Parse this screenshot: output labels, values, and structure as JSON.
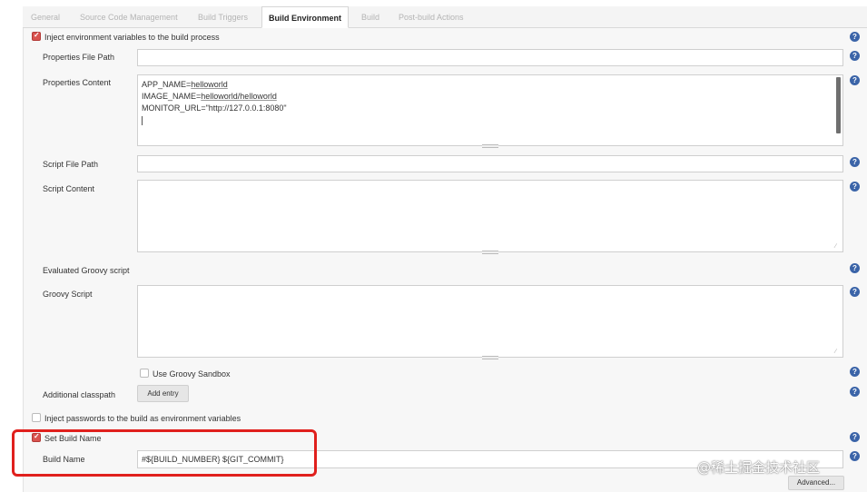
{
  "tabs": [
    {
      "label": "General"
    },
    {
      "label": "Source Code Management"
    },
    {
      "label": "Build Triggers"
    },
    {
      "label": "Build Environment"
    },
    {
      "label": "Build"
    },
    {
      "label": "Post-build Actions"
    }
  ],
  "active_tab": "Build Environment",
  "inject_env": {
    "checkbox_label": "Inject environment variables to the build process",
    "checked": true,
    "properties_file_path": {
      "label": "Properties File Path",
      "value": ""
    },
    "properties_content": {
      "label": "Properties Content",
      "lines": [
        {
          "key": "APP_NAME=",
          "val": "helloworld"
        },
        {
          "key": "IMAGE_NAME=",
          "val": "helloworld/helloworld"
        },
        {
          "key": "MONITOR_URL=\"http://127.0.0.1:8080\"",
          "val": ""
        }
      ]
    },
    "script_file_path": {
      "label": "Script File Path",
      "value": ""
    },
    "script_content": {
      "label": "Script Content",
      "value": ""
    },
    "evaluated_groovy_label": "Evaluated Groovy script",
    "groovy_script": {
      "label": "Groovy Script",
      "value": ""
    },
    "use_groovy_sandbox": {
      "label": "Use Groovy Sandbox",
      "checked": false
    },
    "additional_classpath": {
      "label": "Additional classpath",
      "button": "Add entry"
    }
  },
  "inject_passwords": {
    "label": "Inject passwords to the build as environment variables",
    "checked": false
  },
  "set_build_name": {
    "label": "Set Build Name",
    "checked": true,
    "build_name": {
      "label": "Build Name",
      "value": "#${BUILD_NUMBER} ${GIT_COMMIT}"
    },
    "advanced_button": "Advanced..."
  },
  "help_glyph": "?",
  "watermark": "@稀土掘金技术社区",
  "colors": {
    "checkbox_checked": "#d9534f",
    "help_icon": "#3b64a8",
    "highlight_box": "#e0201d"
  }
}
